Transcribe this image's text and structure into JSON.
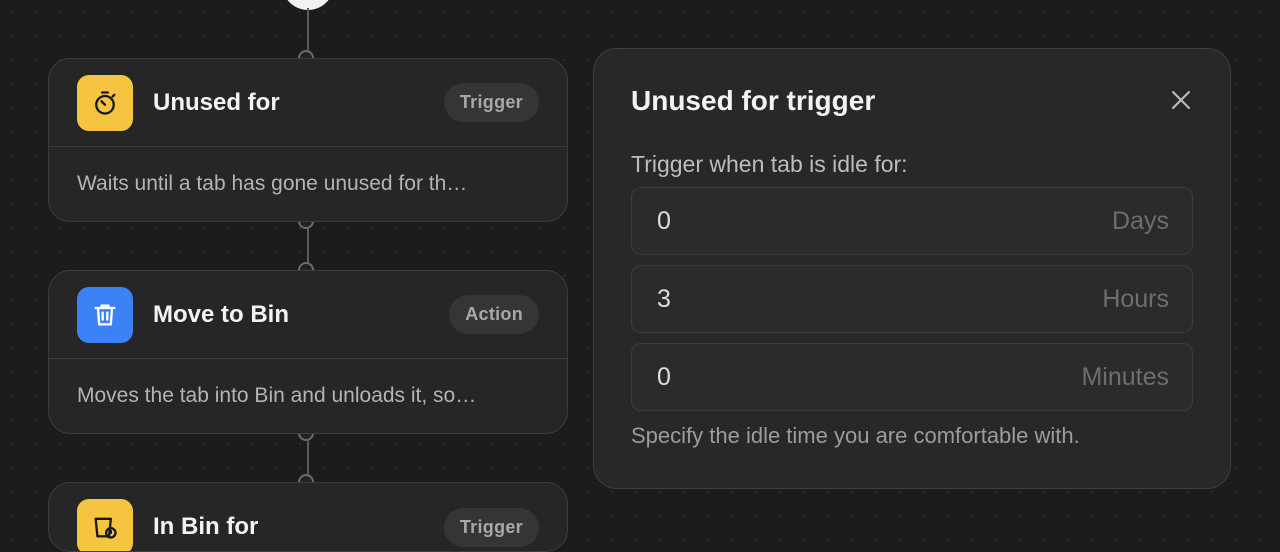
{
  "nodes": [
    {
      "title": "Unused for",
      "badge": "Trigger",
      "description": "Waits until a tab has gone unused for th…",
      "icon": "stopwatch-icon",
      "icon_color": "#f5c542"
    },
    {
      "title": "Move to Bin",
      "badge": "Action",
      "description": "Moves the tab into Bin and unloads it, so…",
      "icon": "trash-icon",
      "icon_color": "#3b82f6"
    },
    {
      "title": "In Bin for",
      "badge": "Trigger",
      "icon": "bin-timer-icon",
      "icon_color": "#f5c542"
    }
  ],
  "panel": {
    "title": "Unused for trigger",
    "label": "Trigger when tab is idle for:",
    "fields": [
      {
        "value": "0",
        "unit": "Days"
      },
      {
        "value": "3",
        "unit": "Hours"
      },
      {
        "value": "0",
        "unit": "Minutes"
      }
    ],
    "help": "Specify the idle time you are comfortable with.",
    "close_icon": "close-icon"
  }
}
